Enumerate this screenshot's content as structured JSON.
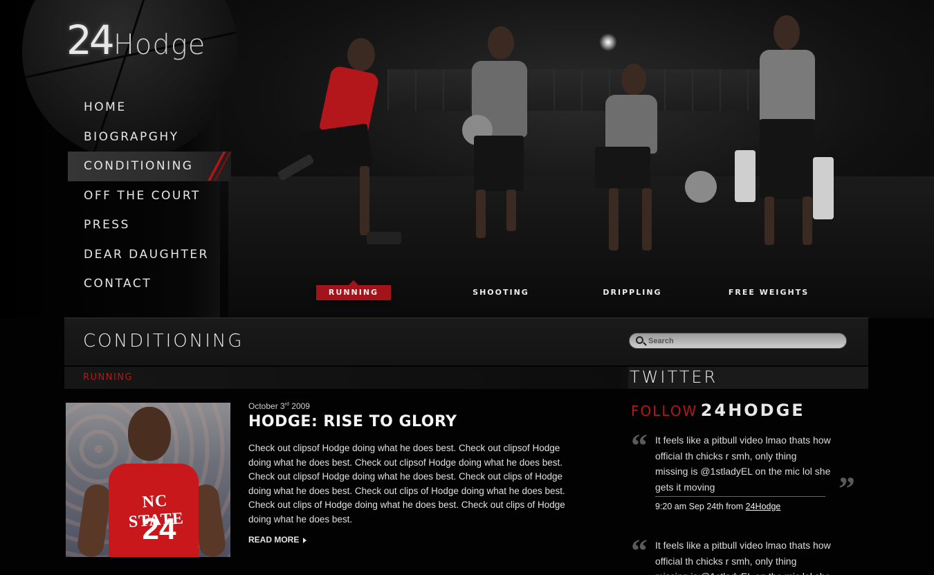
{
  "logo": {
    "number": "24",
    "word": "Hodge"
  },
  "nav": [
    {
      "label": "HOME",
      "active": false
    },
    {
      "label": "BIOGRAPGHY",
      "active": false
    },
    {
      "label": "CONDITIONING",
      "active": true
    },
    {
      "label": "OFF THE COURT",
      "active": false
    },
    {
      "label": "PRESS",
      "active": false
    },
    {
      "label": "DEAR DAUGHTER",
      "active": false
    },
    {
      "label": "CONTACT",
      "active": false
    }
  ],
  "tabs": [
    {
      "label": "RUNNING",
      "active": true
    },
    {
      "label": "SHOOTING",
      "active": false
    },
    {
      "label": "DRIPPLING",
      "active": false
    },
    {
      "label": "FREE WEIGHTS",
      "active": false
    }
  ],
  "section": {
    "title": "CONDITIONING",
    "sub_label": "RUNNING"
  },
  "search": {
    "placeholder": "Search"
  },
  "post": {
    "date_day": "October 3",
    "date_suffix": "rd",
    "date_year": "2009",
    "title": "HODGE: RISE TO GLORY",
    "body": "Check out clipsof Hodge doing what he does best. Check out clipsof Hodge doing what he does best. Check out clipsof Hodge doing what he does best. Check out clipsof Hodge doing what he does best. Check out clips of Hodge doing what he does best. Check out clips of Hodge doing what he does best. Check out clips of Hodge doing what he does best. Check out clips of Hodge doing what he does best.",
    "read_more": "READ MORE",
    "jersey_school": "NC STATE",
    "jersey_number": "24"
  },
  "twitter": {
    "title": "TWITTER",
    "follow_label": "FOLLOW",
    "follow_handle": "24HODGE",
    "tweets": [
      {
        "text": "It feels like a pitbull video lmao thats how official th chicks r smh, only thing missing is @1stladyEL on the mic lol she gets it moving",
        "meta_prefix": "9:20 am Sep 24th from",
        "meta_link": "24Hodge"
      },
      {
        "text": "It feels like a pitbull video lmao thats how official th chicks r smh, only thing missing is @1stladyEL on the mic lol she gets it moving"
      }
    ]
  },
  "colors": {
    "accent_red": "#a3141a",
    "background": "#020202",
    "text": "#e6e6e6"
  }
}
